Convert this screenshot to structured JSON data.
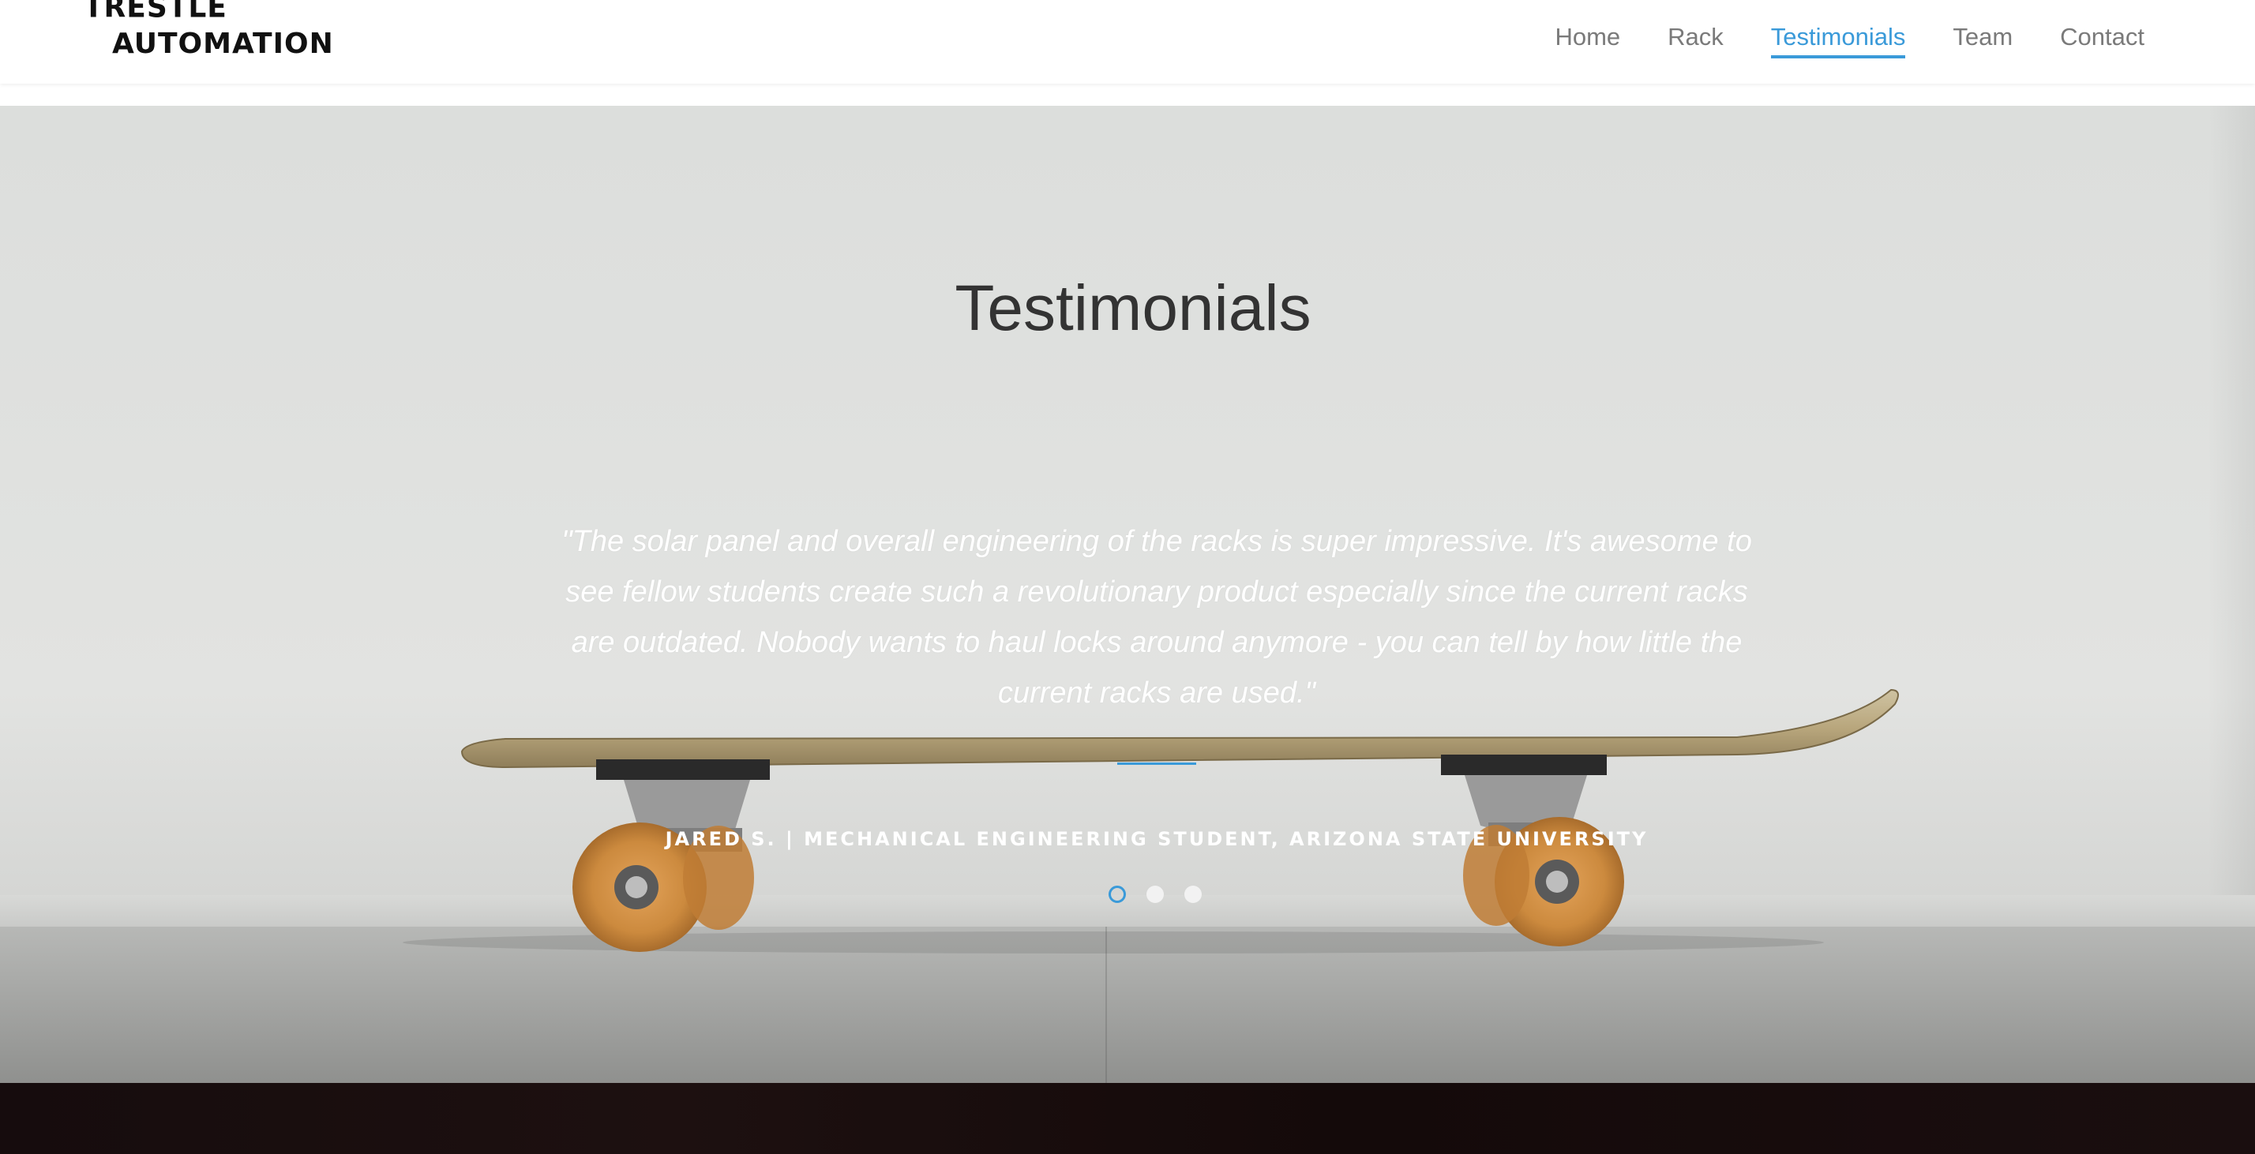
{
  "brand": {
    "line1": "TRESTLE",
    "line2": "AUTOMATION"
  },
  "nav": {
    "items": [
      {
        "label": "Home",
        "active": false
      },
      {
        "label": "Rack",
        "active": false
      },
      {
        "label": "Testimonials",
        "active": true
      },
      {
        "label": "Team",
        "active": false
      },
      {
        "label": "Contact",
        "active": false
      }
    ]
  },
  "testimonials": {
    "title": "Testimonials",
    "quote": "\"The solar panel and overall engineering of the racks is super impressive. It's awesome to see fellow students create such a revolutionary product especially since the current racks are outdated. Nobody wants to haul locks around anymore - you can tell by how little the current racks are used.\"",
    "author": "JARED S. | MECHANICAL ENGINEERING STUDENT, ARIZONA STATE UNIVERSITY",
    "slides_total": 3,
    "active_slide": 1
  },
  "colors": {
    "accent": "#3a9ad9",
    "nav_text": "#7a7a7a",
    "title_text": "#333333",
    "quote_text": "#ffffff",
    "dark_section": "#160c0d"
  }
}
